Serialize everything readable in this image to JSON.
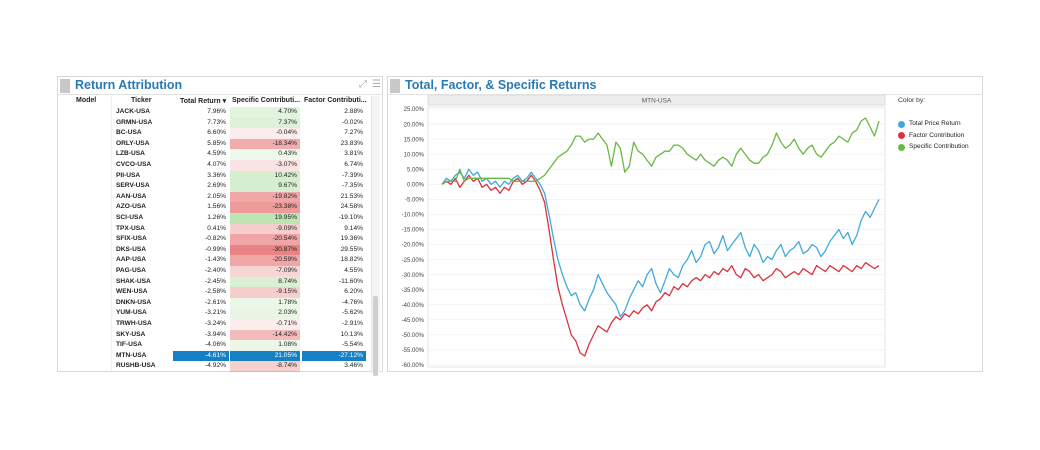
{
  "left_panel": {
    "title": "Return Attribution",
    "icons": {
      "expand": "expand-icon",
      "menu": "menu-icon"
    },
    "columns": [
      "Model",
      "Ticker",
      "Total Return",
      "Specific Contributi...",
      "Factor Contributi..."
    ],
    "sort_indicator": "▾",
    "rows": [
      {
        "ticker": "JACK-USA",
        "total": "7.96%",
        "specific": "4.70%",
        "factor": "2.88%",
        "spec_val": 4.7
      },
      {
        "ticker": "GRMN-USA",
        "total": "7.73%",
        "specific": "7.37%",
        "factor": "-0.02%",
        "spec_val": 7.37
      },
      {
        "ticker": "BC-USA",
        "total": "6.60%",
        "specific": "-0.04%",
        "factor": "7.27%",
        "spec_val": -0.04
      },
      {
        "ticker": "ORLY-USA",
        "total": "5.85%",
        "specific": "-18.34%",
        "factor": "23.83%",
        "spec_val": -18.34
      },
      {
        "ticker": "LZB-USA",
        "total": "4.59%",
        "specific": "0.43%",
        "factor": "3.81%",
        "spec_val": 0.43
      },
      {
        "ticker": "CVCO-USA",
        "total": "4.07%",
        "specific": "-3.07%",
        "factor": "6.74%",
        "spec_val": -3.07
      },
      {
        "ticker": "PII-USA",
        "total": "3.36%",
        "specific": "10.42%",
        "factor": "-7.39%",
        "spec_val": 10.42
      },
      {
        "ticker": "SERV-USA",
        "total": "2.69%",
        "specific": "9.67%",
        "factor": "-7.35%",
        "spec_val": 9.67
      },
      {
        "ticker": "AAN-USA",
        "total": "2.05%",
        "specific": "-19.82%",
        "factor": "21.53%",
        "spec_val": -19.82
      },
      {
        "ticker": "AZO-USA",
        "total": "1.56%",
        "specific": "-23.38%",
        "factor": "24.58%",
        "spec_val": -23.38
      },
      {
        "ticker": "SCI-USA",
        "total": "1.26%",
        "specific": "19.95%",
        "factor": "-19.10%",
        "spec_val": 19.95
      },
      {
        "ticker": "TPX-USA",
        "total": "0.41%",
        "specific": "-9.09%",
        "factor": "9.14%",
        "spec_val": -9.09
      },
      {
        "ticker": "SFIX-USA",
        "total": "-0.82%",
        "specific": "-20.54%",
        "factor": "19.36%",
        "spec_val": -20.54
      },
      {
        "ticker": "DKS-USA",
        "total": "-0.99%",
        "specific": "-30.87%",
        "factor": "29.55%",
        "spec_val": -30.87
      },
      {
        "ticker": "AAP-USA",
        "total": "-1.43%",
        "specific": "-20.59%",
        "factor": "18.82%",
        "spec_val": -20.59
      },
      {
        "ticker": "PAG-USA",
        "total": "-2.40%",
        "specific": "-7.09%",
        "factor": "4.55%",
        "spec_val": -7.09
      },
      {
        "ticker": "SHAK-USA",
        "total": "-2.45%",
        "specific": "8.74%",
        "factor": "-11.60%",
        "spec_val": 8.74
      },
      {
        "ticker": "WEN-USA",
        "total": "-2.58%",
        "specific": "-9.15%",
        "factor": "6.20%",
        "spec_val": -9.15
      },
      {
        "ticker": "DNKN-USA",
        "total": "-2.61%",
        "specific": "1.78%",
        "factor": "-4.76%",
        "spec_val": 1.78
      },
      {
        "ticker": "YUM-USA",
        "total": "-3.21%",
        "specific": "2.03%",
        "factor": "-5.62%",
        "spec_val": 2.03
      },
      {
        "ticker": "TRWH-USA",
        "total": "-3.24%",
        "specific": "-0.71%",
        "factor": "-2.91%",
        "spec_val": -0.71
      },
      {
        "ticker": "SKY-USA",
        "total": "-3.94%",
        "specific": "-14.42%",
        "factor": "10.13%",
        "spec_val": -14.42
      },
      {
        "ticker": "TIF-USA",
        "total": "-4.06%",
        "specific": "1.08%",
        "factor": "-5.54%",
        "spec_val": 1.08
      },
      {
        "ticker": "MTN-USA",
        "total": "-4.61%",
        "specific": "21.05%",
        "factor": "-27.12%",
        "spec_val": 21.05,
        "selected": true
      },
      {
        "ticker": "RUSHB-USA",
        "total": "-4.92%",
        "specific": "-8.74%",
        "factor": "3.46%",
        "spec_val": -8.74
      }
    ]
  },
  "right_panel": {
    "title": "Total, Factor, & Specific Returns",
    "legend_title": "Color by:"
  },
  "chart_data": {
    "type": "line",
    "title": "MTN-USA",
    "ylim": [
      -60,
      25
    ],
    "yticks": [
      "25.00%",
      "20.00%",
      "15.00%",
      "10.00%",
      "5.00%",
      "0.00%",
      "-5.00%",
      "-10.00%",
      "-15.00%",
      "-20.00%",
      "-25.00%",
      "-30.00%",
      "-35.00%",
      "-40.00%",
      "-45.00%",
      "-50.00%",
      "-55.00%",
      "-60.00%"
    ],
    "grid": true,
    "legend_position": "right",
    "series": [
      {
        "name": "Total Price Return",
        "color": "#3fa9dc",
        "values": [
          0,
          2,
          1,
          3,
          4,
          2,
          5,
          3,
          4,
          1,
          2,
          0,
          1,
          -1,
          1,
          0,
          2,
          3,
          1,
          2,
          4,
          2,
          0,
          -3,
          -10,
          -18,
          -25,
          -30,
          -34,
          -37,
          -36,
          -40,
          -42,
          -38,
          -35,
          -30,
          -33,
          -36,
          -38,
          -40,
          -44,
          -42,
          -38,
          -35,
          -32,
          -34,
          -30,
          -28,
          -33,
          -36,
          -32,
          -28,
          -30,
          -31,
          -27,
          -25,
          -22,
          -26,
          -24,
          -20,
          -19,
          -23,
          -21,
          -17,
          -22,
          -20,
          -18,
          -16,
          -21,
          -24,
          -20,
          -22,
          -26,
          -24,
          -25,
          -22,
          -20,
          -24,
          -22,
          -21,
          -19,
          -23,
          -22,
          -20,
          -21,
          -24,
          -22,
          -19,
          -17,
          -15,
          -18,
          -16,
          -20,
          -17,
          -12,
          -9,
          -11,
          -8,
          -5
        ]
      },
      {
        "name": "Factor Contribution",
        "color": "#d8343f",
        "values": [
          0,
          1,
          0,
          2,
          -1,
          1,
          3,
          1,
          2,
          -1,
          0,
          -2,
          -1,
          -3,
          -1,
          -2,
          1,
          2,
          0,
          1,
          3,
          1,
          -2,
          -6,
          -15,
          -25,
          -34,
          -40,
          -45,
          -50,
          -52,
          -56,
          -57,
          -53,
          -50,
          -47,
          -48,
          -49,
          -46,
          -44,
          -45,
          -43,
          -44,
          -42,
          -43,
          -41,
          -40,
          -42,
          -39,
          -38,
          -36,
          -37,
          -34,
          -35,
          -33,
          -34,
          -32,
          -31,
          -32,
          -30,
          -31,
          -29,
          -30,
          -28,
          -29,
          -27,
          -30,
          -31,
          -28,
          -29,
          -31,
          -30,
          -32,
          -31,
          -30,
          -28,
          -29,
          -31,
          -30,
          -29,
          -30,
          -28,
          -29,
          -30,
          -27,
          -28,
          -29,
          -27,
          -28,
          -29,
          -27,
          -28,
          -29,
          -27,
          -28,
          -26,
          -27,
          -28,
          -27
        ]
      },
      {
        "name": "Specific Contribution",
        "color": "#6ab844",
        "values": [
          0,
          1,
          1,
          1,
          5,
          1,
          2,
          2,
          2,
          2,
          2,
          2,
          2,
          2,
          2,
          2,
          1,
          1,
          1,
          1,
          1,
          1,
          2,
          3,
          5,
          7,
          9,
          10,
          11,
          13,
          16,
          16,
          14,
          15,
          15,
          17,
          15,
          13,
          6,
          14,
          12,
          4,
          6,
          14,
          11,
          10,
          8,
          6,
          9,
          10,
          11,
          11,
          13,
          13,
          12,
          10,
          9,
          8,
          10,
          8,
          7,
          6,
          8,
          9,
          8,
          6,
          10,
          12,
          10,
          8,
          7,
          7,
          9,
          10,
          13,
          17,
          14,
          12,
          13,
          15,
          12,
          10,
          12,
          13,
          10,
          9,
          11,
          13,
          14,
          16,
          15,
          14,
          17,
          18,
          21,
          22,
          19,
          16,
          21
        ]
      }
    ]
  }
}
